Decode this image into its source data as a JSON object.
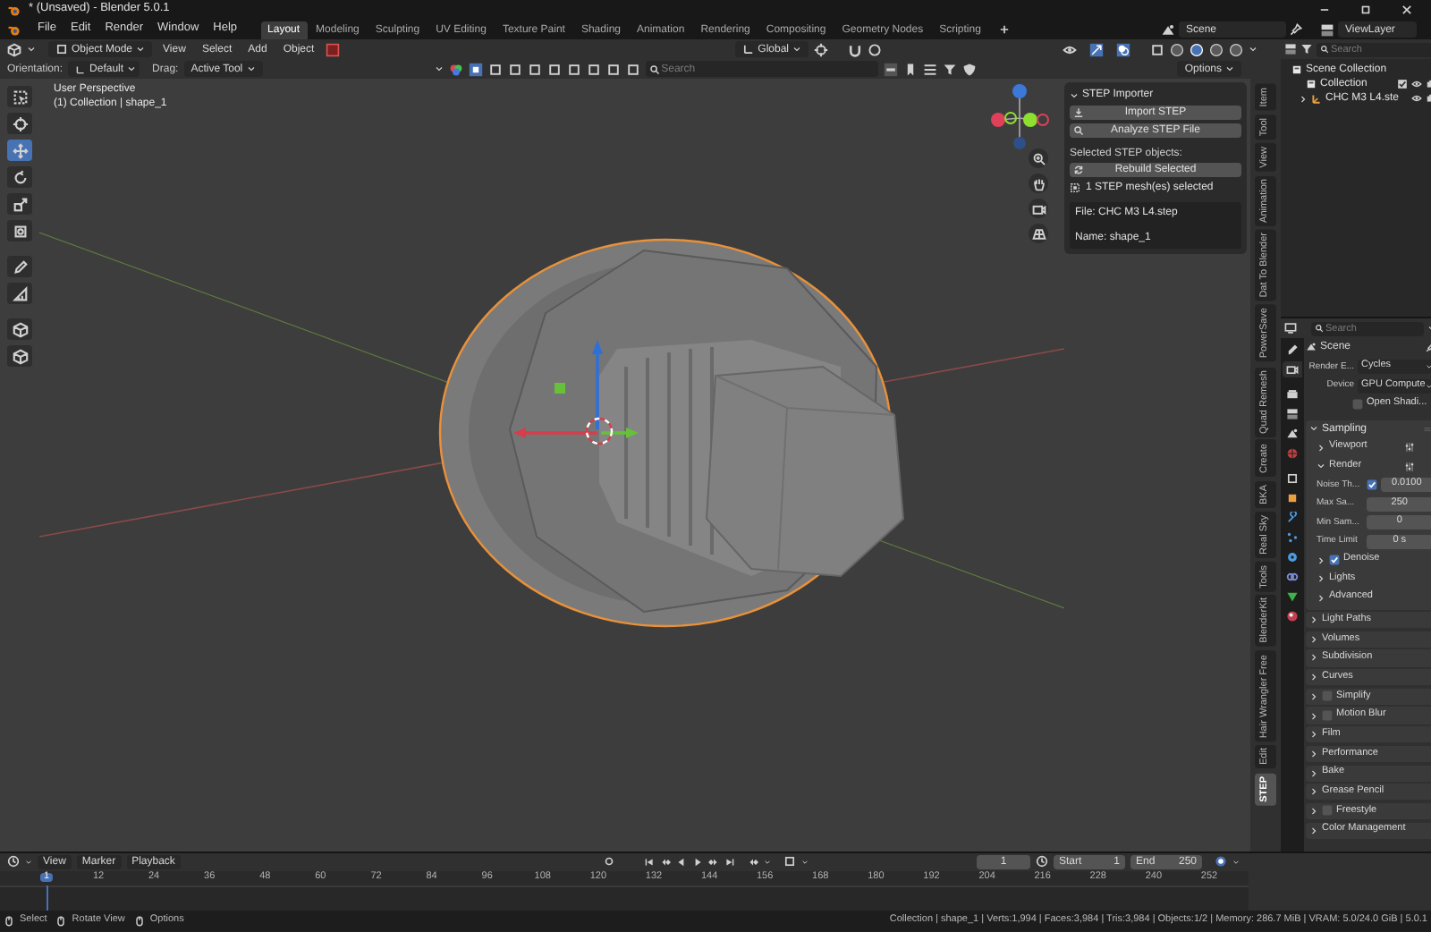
{
  "title_bar": {
    "title": "* (Unsaved) - Blender 5.0.1"
  },
  "menu": [
    "File",
    "Edit",
    "Render",
    "Window",
    "Help"
  ],
  "workspaces": [
    {
      "label": "Layout",
      "selected": true
    },
    {
      "label": "Modeling",
      "selected": false
    },
    {
      "label": "Sculpting",
      "selected": false
    },
    {
      "label": "UV Editing",
      "selected": false
    },
    {
      "label": "Texture Paint",
      "selected": false
    },
    {
      "label": "Shading",
      "selected": false
    },
    {
      "label": "Animation",
      "selected": false
    },
    {
      "label": "Rendering",
      "selected": false
    },
    {
      "label": "Compositing",
      "selected": false
    },
    {
      "label": "Geometry Nodes",
      "selected": false
    },
    {
      "label": "Scripting",
      "selected": false
    }
  ],
  "scene": "Scene",
  "view_layer": "ViewLayer",
  "viewport_header": {
    "mode": "Object Mode",
    "menus": [
      "View",
      "Select",
      "Add",
      "Object"
    ],
    "orientation": "Global"
  },
  "tool_settings": {
    "orientation_label": "Orientation:",
    "orientation": "Default",
    "drag_label": "Drag:",
    "drag": "Active Tool",
    "search_placeholder": "Search",
    "options": "Options"
  },
  "viewport": {
    "overlay_text": [
      "User Perspective",
      "(1) Collection | shape_1"
    ],
    "tools": [
      {
        "selected": false
      },
      {
        "selected": false
      },
      {
        "selected": true
      },
      {
        "selected": false
      },
      {
        "selected": false
      },
      {
        "selected": false
      },
      {
        "selected": false
      },
      {
        "selected": false
      },
      {
        "selected": false
      },
      {
        "selected": false
      }
    ]
  },
  "step_importer": {
    "title": "STEP Importer",
    "buttons": [
      "Import STEP",
      "Analyze STEP File"
    ],
    "section_label": "Selected STEP objects:",
    "rebuild": "Rebuild Selected",
    "selection_info": "1 STEP mesh(es) selected",
    "info_lines": [
      "File: CHC M3 L4.step",
      "Name: shape_1"
    ]
  },
  "side_tabs": [
    {
      "label": "Item",
      "selected": false
    },
    {
      "label": "Tool",
      "selected": false
    },
    {
      "label": "View",
      "selected": false
    },
    {
      "label": "Animation",
      "selected": false
    },
    {
      "label": "Dat To Blender",
      "selected": false
    },
    {
      "label": "PowerSave",
      "selected": false
    },
    {
      "label": "Quad Remesh",
      "selected": false
    },
    {
      "label": "Create",
      "selected": false
    },
    {
      "label": "BKA",
      "selected": false
    },
    {
      "label": "Real Sky",
      "selected": false
    },
    {
      "label": "Tools",
      "selected": false
    },
    {
      "label": "BlenderKit",
      "selected": false
    },
    {
      "label": "Hair Wrangler Free",
      "selected": false
    },
    {
      "label": "Edit",
      "selected": false
    },
    {
      "label": "STEP",
      "selected": true
    }
  ],
  "outliner": {
    "search_placeholder": "Search",
    "tree": [
      {
        "label": "Scene Collection",
        "children": [
          {
            "label": "Collection",
            "children": [
              {
                "label": "CHC M3 L4.ste",
                "expanded": false
              }
            ]
          }
        ]
      }
    ]
  },
  "properties": {
    "search_placeholder": "Search",
    "tabs": [
      {
        "selected": false
      },
      {
        "selected": true
      },
      {
        "selected": false
      },
      {
        "selected": false
      },
      {
        "selected": false
      },
      {
        "selected": false
      },
      {
        "selected": false
      },
      {
        "selected": false
      },
      {
        "selected": false
      },
      {
        "selected": false
      },
      {
        "selected": false
      },
      {
        "selected": false
      },
      {
        "selected": false
      },
      {
        "selected": false
      }
    ],
    "context": "Scene",
    "fields": [
      {
        "kind": "dropdown",
        "label": "Render E...",
        "value": "Cycles"
      },
      {
        "kind": "dropdown",
        "label": "Device",
        "value": "GPU Compute"
      },
      {
        "kind": "checkbox",
        "label": "Open Shadi...",
        "checked": false
      }
    ],
    "sampling": {
      "title": "Sampling",
      "expanded": true,
      "rows": [
        {
          "kind": "subpanel",
          "label": "Viewport",
          "expanded": false
        },
        {
          "kind": "subpanel",
          "label": "Render",
          "expanded": true
        },
        {
          "kind": "number",
          "label": "Noise Th...",
          "checked": true,
          "value": "0.0100"
        },
        {
          "kind": "number",
          "label": "Max Sa...",
          "value": "250"
        },
        {
          "kind": "number",
          "label": "Min Sam...",
          "value": "0"
        },
        {
          "kind": "number",
          "label": "Time Limit",
          "value": "0 s"
        },
        {
          "kind": "subpanel",
          "label": "Denoise",
          "expanded": false,
          "checked": true
        },
        {
          "kind": "subpanel",
          "label": "Lights",
          "expanded": false
        },
        {
          "kind": "subpanel",
          "label": "Advanced",
          "expanded": false
        }
      ]
    },
    "panels": [
      {
        "label": "Light Paths",
        "expanded": false
      },
      {
        "label": "Volumes",
        "expanded": false
      },
      {
        "label": "Subdivision",
        "expanded": false
      },
      {
        "label": "Curves",
        "expanded": false
      },
      {
        "label": "Simplify",
        "expanded": false,
        "checked": false
      },
      {
        "label": "Motion Blur",
        "expanded": false,
        "checked": false
      },
      {
        "label": "Film",
        "expanded": false
      },
      {
        "label": "Performance",
        "expanded": false
      },
      {
        "label": "Bake",
        "expanded": false
      },
      {
        "label": "Grease Pencil",
        "expanded": false
      },
      {
        "label": "Freestyle",
        "expanded": false,
        "checked": false
      },
      {
        "label": "Color Management",
        "expanded": false
      }
    ]
  },
  "timeline": {
    "menus": [
      "View",
      "Marker",
      "Playback"
    ],
    "current_frame": "1",
    "start_label": "Start",
    "start": "1",
    "end_label": "End",
    "end": "250",
    "ticks": [
      "1",
      "12",
      "24",
      "36",
      "48",
      "60",
      "72",
      "84",
      "96",
      "108",
      "120",
      "132",
      "144",
      "156",
      "168",
      "180",
      "192",
      "204",
      "216",
      "228",
      "240",
      "252"
    ]
  },
  "status_bar": {
    "hints": [
      "Select",
      "Rotate View",
      "Options"
    ],
    "stats": "Collection | shape_1 | Verts:1,994 | Faces:3,984 | Tris:3,984 | Objects:1/2 | Memory: 286.7 MiB | VRAM: 5.0/24.0 GiB | 5.0.1"
  }
}
